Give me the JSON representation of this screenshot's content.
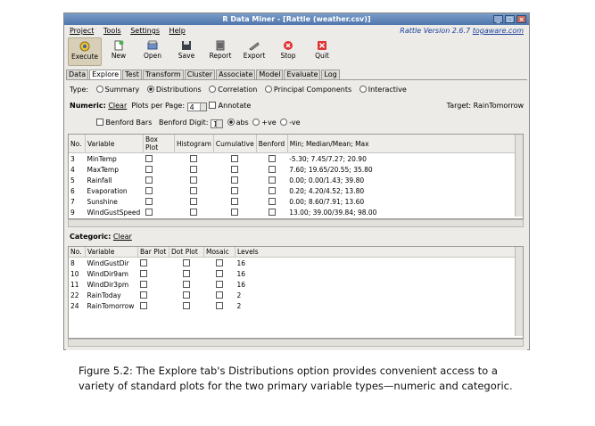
{
  "window": {
    "title": "R Data Miner - [Rattle (weather.csv)]",
    "version_text": "Rattle Version 2.6.7",
    "version_link": "togaware.com"
  },
  "menu": [
    "Project",
    "Tools",
    "Settings",
    "Help"
  ],
  "toolbar": [
    {
      "label": "Execute",
      "icon": "execute-icon"
    },
    {
      "label": "New",
      "icon": "new-icon"
    },
    {
      "label": "Open",
      "icon": "open-icon"
    },
    {
      "label": "Save",
      "icon": "save-icon"
    },
    {
      "label": "Report",
      "icon": "report-icon"
    },
    {
      "label": "Export",
      "icon": "export-icon"
    },
    {
      "label": "Stop",
      "icon": "stop-icon"
    },
    {
      "label": "Quit",
      "icon": "quit-icon"
    }
  ],
  "tabs": [
    "Data",
    "Explore",
    "Test",
    "Transform",
    "Cluster",
    "Associate",
    "Model",
    "Evaluate",
    "Log"
  ],
  "type_row": {
    "label": "Type:",
    "options": [
      "Summary",
      "Distributions",
      "Correlation",
      "Principal Components",
      "Interactive"
    ],
    "selected": "Distributions"
  },
  "numeric_row": {
    "label": "Numeric:",
    "clear": "Clear",
    "plots_label": "Plots per Page:",
    "plots_value": "4",
    "annotate": "Annotate",
    "target": "Target: RainTomorrow"
  },
  "benford_row": {
    "benford_bars": "Benford Bars",
    "digit_label": "Benford Digit:",
    "digit_value": "1",
    "options": [
      "abs",
      "+ve",
      "-ve"
    ]
  },
  "numeric_table": {
    "headers": [
      "No.",
      "Variable",
      "Box Plot",
      "Histogram",
      "Cumulative",
      "Benford",
      "Min; Median/Mean; Max"
    ],
    "rows": [
      {
        "no": "3",
        "var": "MinTemp",
        "stats": "-5.30; 7.45/7.27; 20.90"
      },
      {
        "no": "4",
        "var": "MaxTemp",
        "stats": "7.60; 19.65/20.55; 35.80"
      },
      {
        "no": "5",
        "var": "Rainfall",
        "stats": "0.00; 0.00/1.43; 39.80"
      },
      {
        "no": "6",
        "var": "Evaporation",
        "stats": "0.20; 4.20/4.52; 13.80"
      },
      {
        "no": "7",
        "var": "Sunshine",
        "stats": "0.00; 8.60/7.91; 13.60"
      },
      {
        "no": "9",
        "var": "WindGustSpeed",
        "stats": "13.00; 39.00/39.84; 98.00"
      }
    ]
  },
  "categoric_row": {
    "label": "Categoric:",
    "clear": "Clear"
  },
  "categoric_table": {
    "headers": [
      "No.",
      "Variable",
      "Bar Plot",
      "Dot Plot",
      "Mosaic",
      "Levels"
    ],
    "rows": [
      {
        "no": "8",
        "var": "WindGustDir",
        "levels": "16"
      },
      {
        "no": "10",
        "var": "WindDir9am",
        "levels": "16"
      },
      {
        "no": "11",
        "var": "WindDir3pm",
        "levels": "16"
      },
      {
        "no": "22",
        "var": "RainToday",
        "levels": "2"
      },
      {
        "no": "24",
        "var": "RainTomorrow",
        "levels": "2"
      }
    ]
  },
  "caption": "Figure 5.2: The Explore tab's Distributions option provides convenient access to a variety of standard plots for the two primary variable types—numeric and categoric."
}
